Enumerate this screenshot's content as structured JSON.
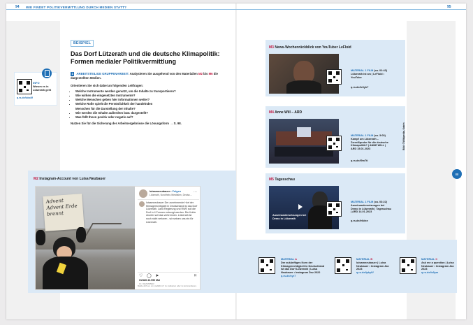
{
  "header": {
    "left_page_number": "94",
    "left_title": "WIE FINDET POLITIKVERMITTLUNG DURCH MEDIEN STATT?",
    "right_page_number": "95"
  },
  "example_tag": "BEISPIEL",
  "title": "Das Dorf Lützerath und die deutsche Klimapolitik: Formen medialer Politikvermittlung",
  "task": {
    "number": "1",
    "lead": "ARBEITSTEILIGE GRUPPENARBEIT:",
    "text_a": "Analysieren Sie ausgehend von den Materialien",
    "m1": "M2",
    "mid": "bis",
    "m2": "M6",
    "text_b": "die dargestellten Medien.",
    "intro": "Orientieren Sie sich dabei an folgenden Leitfragen:",
    "questions": [
      "Welche Instrumente werden genutzt, um die Inhalte zu transportieren?",
      "Wie wirken die eingesetzten Instrumente?",
      "Welche Menschen geben hier Informationen weiter?",
      "Welche Rolle spielt die Persönlichkeit der handelnden Menschen für die Darstellung der Inhalte?",
      "Wie werden die Inhalte außerdem bzw. dargestellt?",
      "Was füllt Ihnen positiv oder negativ auf?"
    ],
    "footer": "Nutzen Sie für die Sicherung der Arbeitsergebnisse die Lösungsform → S. 98."
  },
  "info": {
    "label": "INFO",
    "text": "Warum es in Lützerath geht",
    "link": "q.rs.de/lubc8f"
  },
  "m2": {
    "num": "M2",
    "title": "Instagram-Account von Luisa Neubauer",
    "sign_text": "Advent Advent Erde brennt",
    "account": "luisamneubauer",
    "follow": "Folgen",
    "location": "Lützerath, Nordrhein-Westfalen, Deutsc…",
    "post_text": "luisamneubauer Der zunehmende Hort der Klimagerechtigkeit in Deutschland ist das Dorf Lützerath. Land Regierung und RWE soll die Dorf in 4 Formen entsorgt werden. Die Kohle drunter soll das verbrennen. Lützerath ist noch nicht verloren - wir setzen uns ein für Lützerath.",
    "likes": "Gefällt 43.950 Mal",
    "date": "10. DEZEMBER",
    "comment_hint": "Melde dich an, um „Gefällt mir“ zu markieren oder zu kommentieren."
  },
  "m3": {
    "num": "M3",
    "title": "News-Wochenrückblick von YouTuber LeFloid",
    "material": "MATERIAL 1 FILM",
    "duration": "(ca. 02:43)",
    "desc": "Lützerath ist wo | LeFloid • YouTube",
    "link": "q.rs.de/lc9yh7"
  },
  "m4": {
    "num": "M4",
    "title": "Anne Will – ARD",
    "material": "MATERIAL 1 FILM",
    "duration": "(ca. 3:00)",
    "desc": "Kampf um Lützerath – Zerreißprobe für die deutsche Klimapolitik? | ANNE WILL | ARD 15.01.2023",
    "link": "q.rs.de/l9m7ti"
  },
  "m5": {
    "num": "M5",
    "title": "Tagesschau",
    "material": "MATERIAL 1 FILM",
    "duration": "(ca. 03:22)",
    "desc": "Auseinandersetzungen bei Demo in Lützerath | Tagesschau | ARD 14.01.2023",
    "link": "q.rs.de/lr6dxe",
    "overlay": "Auseinandersetzungen bei Demo in Lützerath"
  },
  "materials": [
    {
      "label": "MATERIAL",
      "letter": "A",
      "text": "Der zukünftiges Korn der Klimagerechtigkeit in Deutschland ist das Dorf Lützerath | Luisa Neubauer • Instagram Dez 2022",
      "link": "q.rs.de/xyr7"
    },
    {
      "label": "MATERIAL",
      "letter": "B",
      "text": "luisamneubauer | Luisa Neubauer • Instagram Jan 2023",
      "link": "q.rs.de/lpkyfV"
    },
    {
      "label": "MATERIAL",
      "letter": "C",
      "text": "Ask me a question | Luisa Neubauer • Instagram Jan 2023",
      "link": "q.rs.de/ls9ym"
    }
  ],
  "credit": "Bild: ©Wikipedia, Katrin",
  "side_badge": "III",
  "colors": {
    "accent": "#1f6fb5",
    "material_red": "#c0143c",
    "panel": "#dbe9f6"
  }
}
